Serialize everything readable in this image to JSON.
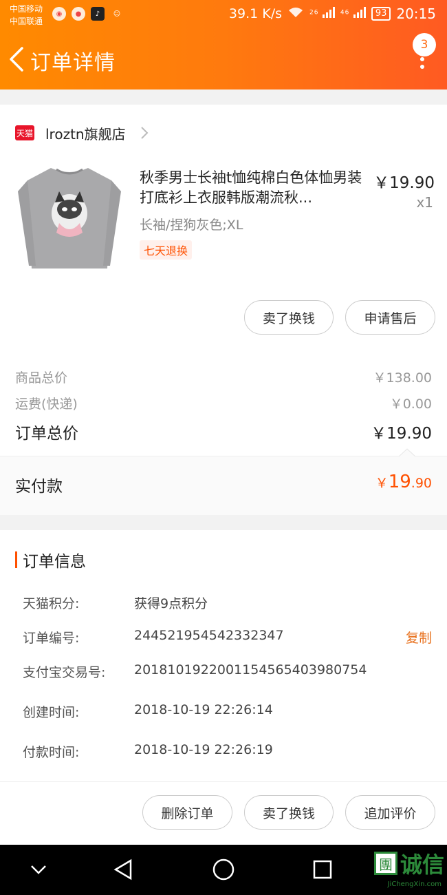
{
  "status_bar": {
    "carrier_1": "中国移动",
    "carrier_2": "中国联通",
    "net_speed": "39.1 K/s",
    "signal_1": "26",
    "signal_2": "46",
    "battery": "93",
    "time": "20:15"
  },
  "header": {
    "title": "订单详情",
    "badge_count": "3"
  },
  "shop": {
    "tmall_label": "天猫",
    "name": "lroztn旗舰店"
  },
  "product": {
    "title": "秋季男士长袖t恤纯棉白色体恤男装打底衫上衣服韩版潮流秋...",
    "price": "￥19.90",
    "quantity": "x1",
    "sku": "长袖/捏狗灰色;XL",
    "tag": "七天退换"
  },
  "actions_top": {
    "sell_label": "卖了换钱",
    "aftersale_label": "申请售后"
  },
  "summary": {
    "goods_total_label": "商品总价",
    "goods_total_value": "￥138.00",
    "shipping_label": "运费(快递)",
    "shipping_value": "￥0.00",
    "order_total_label": "订单总价",
    "order_total_value": "￥19.90",
    "paid_label": "实付款",
    "paid_currency": "￥",
    "paid_integer": "19",
    "paid_decimal": ".90"
  },
  "order_info": {
    "title": "订单信息",
    "points_label": "天猫积分:",
    "points_value": "获得9点积分",
    "order_no_label": "订单编号:",
    "order_no_value": "244521954542332347",
    "copy_label": "复制",
    "alipay_label": "支付宝交易号:",
    "alipay_value": "2018101922001154565403980754",
    "created_label": "创建时间:",
    "created_value": "2018-10-19 22:26:14",
    "paid_time_label": "付款时间:",
    "paid_time_value": "2018-10-19 22:26:19"
  },
  "actions_bottom": {
    "delete_label": "删除订单",
    "sell_label": "卖了换钱",
    "review_label": "追加评价"
  },
  "watermark": {
    "box_char": "團",
    "text": "诚信",
    "sub": "JiChengXin.com"
  },
  "colors": {
    "header_gradient_start": "#ff8a00",
    "header_gradient_end": "#ff5a22",
    "accent": "#ff5000",
    "copy_link": "#e8721f",
    "tmall_red": "#e8152a"
  }
}
